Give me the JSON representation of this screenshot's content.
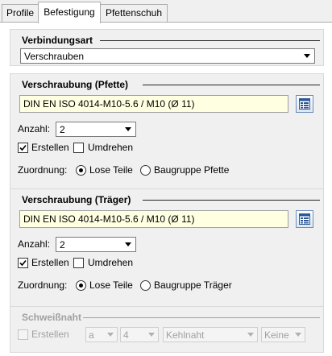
{
  "tabs": [
    "Profile",
    "Befestigung",
    "Pfettenschuh"
  ],
  "active_tab": "Befestigung",
  "verbindungsart": {
    "title": "Verbindungsart",
    "selected": "Verschrauben"
  },
  "pfette": {
    "title": "Verschraubung (Pfette)",
    "bolt": "DIN EN ISO 4014-M10-5.6 / M10 (Ø 11)",
    "anzahl_label": "Anzahl:",
    "anzahl_value": "2",
    "erstellen_label": "Erstellen",
    "erstellen_checked": true,
    "umdrehen_label": "Umdrehen",
    "umdrehen_checked": false,
    "zuordnung_label": "Zuordnung:",
    "option_lose": "Lose Teile",
    "option_baugruppe": "Baugruppe Pfette",
    "selected_option": "Lose Teile"
  },
  "traeger": {
    "title": "Verschraubung (Träger)",
    "bolt": "DIN EN ISO 4014-M10-5.6 / M10 (Ø 11)",
    "anzahl_label": "Anzahl:",
    "anzahl_value": "2",
    "erstellen_label": "Erstellen",
    "erstellen_checked": true,
    "umdrehen_label": "Umdrehen",
    "umdrehen_checked": false,
    "zuordnung_label": "Zuordnung:",
    "option_lose": "Lose Teile",
    "option_baugruppe": "Baugruppe Träger",
    "selected_option": "Lose Teile"
  },
  "schweissnaht": {
    "title": "Schweißnaht",
    "erstellen_label": "Erstellen",
    "dropdown_a": "a",
    "dropdown_size": "4",
    "dropdown_type": "Kehlnaht",
    "dropdown_extra": "Keine",
    "enabled": false
  },
  "icons": {
    "library_button": "library-icon",
    "checkmark": "checkmark-icon",
    "dropdown_arrow": "chevron-down-icon"
  },
  "colors": {
    "bolt_field_bg": "#ffffe1",
    "group_bg": "#f0f0f0",
    "disabled_text": "#a0a0a0"
  }
}
